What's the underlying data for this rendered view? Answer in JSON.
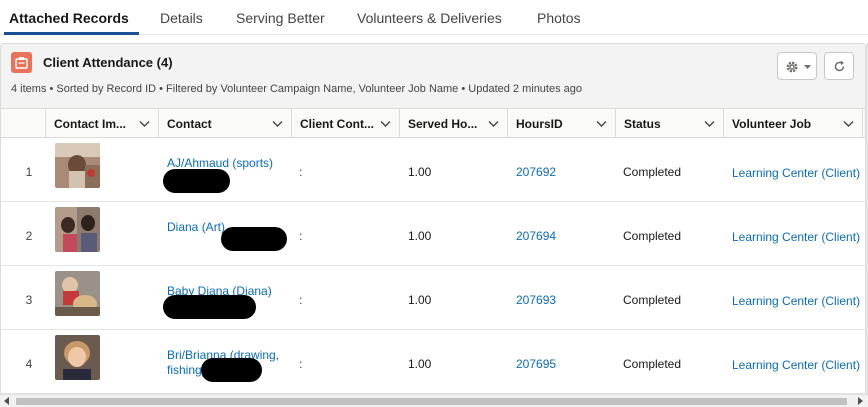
{
  "tabs": [
    {
      "label": "Attached Records",
      "active": true
    },
    {
      "label": "Details"
    },
    {
      "label": "Serving Better"
    },
    {
      "label": "Volunteers & Deliveries"
    },
    {
      "label": "Photos"
    }
  ],
  "card": {
    "title": "Client Attendance (4)",
    "meta": "4 items • Sorted by Record ID • Filtered by Volunteer Campaign Name, Volunteer Job Name • Updated 2 minutes ago",
    "icon_color": "#e8735b"
  },
  "columns": [
    {
      "label": "Contact Im..."
    },
    {
      "label": "Contact"
    },
    {
      "label": "Client Cont..."
    },
    {
      "label": "Served Ho..."
    },
    {
      "label": "HoursID"
    },
    {
      "label": "Status"
    },
    {
      "label": "Volunteer Job"
    }
  ],
  "rows": [
    {
      "num": "1",
      "contact": "AJ/Ahmaud (sports)",
      "client_contact": ":",
      "served": "1.00",
      "hours_id": "207692",
      "status": "Completed",
      "job": "Learning Center (Client)"
    },
    {
      "num": "2",
      "contact": "Diana (Art)",
      "client_contact": ":",
      "served": "1.00",
      "hours_id": "207694",
      "status": "Completed",
      "job": "Learning Center (Client)"
    },
    {
      "num": "3",
      "contact": "Baby Diana (Diana)",
      "client_contact": ":",
      "served": "1.00",
      "hours_id": "207693",
      "status": "Completed",
      "job": "Learning Center (Client)"
    },
    {
      "num": "4",
      "contact": "Bri/Brianna (drawing, fishing)",
      "client_contact": ":",
      "served": "1.00",
      "hours_id": "207695",
      "status": "Completed",
      "job": "Learning Center (Client)"
    }
  ],
  "colors": {
    "link": "#0b6ab8",
    "tab_underline": "#1b5297"
  },
  "icons": {
    "card": "clipboard-icon",
    "settings": "gear-icon",
    "refresh": "refresh-icon",
    "sort": "chevron-down-icon"
  }
}
